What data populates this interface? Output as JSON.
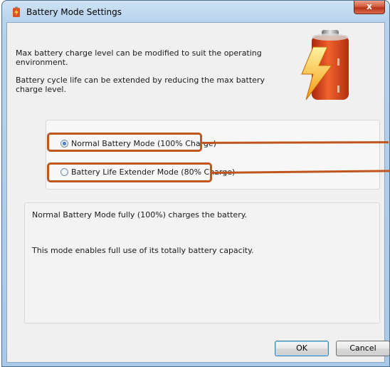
{
  "window": {
    "title": "Battery Mode Settings",
    "close_glyph": "x"
  },
  "intro": {
    "paragraph1": "Max battery charge level can be modified to suit the operating environment.",
    "paragraph2": "Battery cycle life can be extended by reducing the max battery charge level."
  },
  "battery_art": {
    "icon": "battery-lightning-icon",
    "colors": {
      "body": "#e04a1a",
      "cap": "#9a9a9a",
      "bolt": "#f6b21c"
    }
  },
  "modes": {
    "options": [
      {
        "label": "Normal Battery Mode (100% Charge)",
        "selected": true
      },
      {
        "label": "Battery Life Extender Mode (80% Charge)",
        "selected": false
      }
    ]
  },
  "description": {
    "line1": "Normal Battery Mode fully (100%) charges the battery.",
    "line2": "This mode enables full use of its totally battery capacity."
  },
  "buttons": {
    "ok": "OK",
    "cancel": "Cancel"
  },
  "annotation_color": "#c0561e"
}
